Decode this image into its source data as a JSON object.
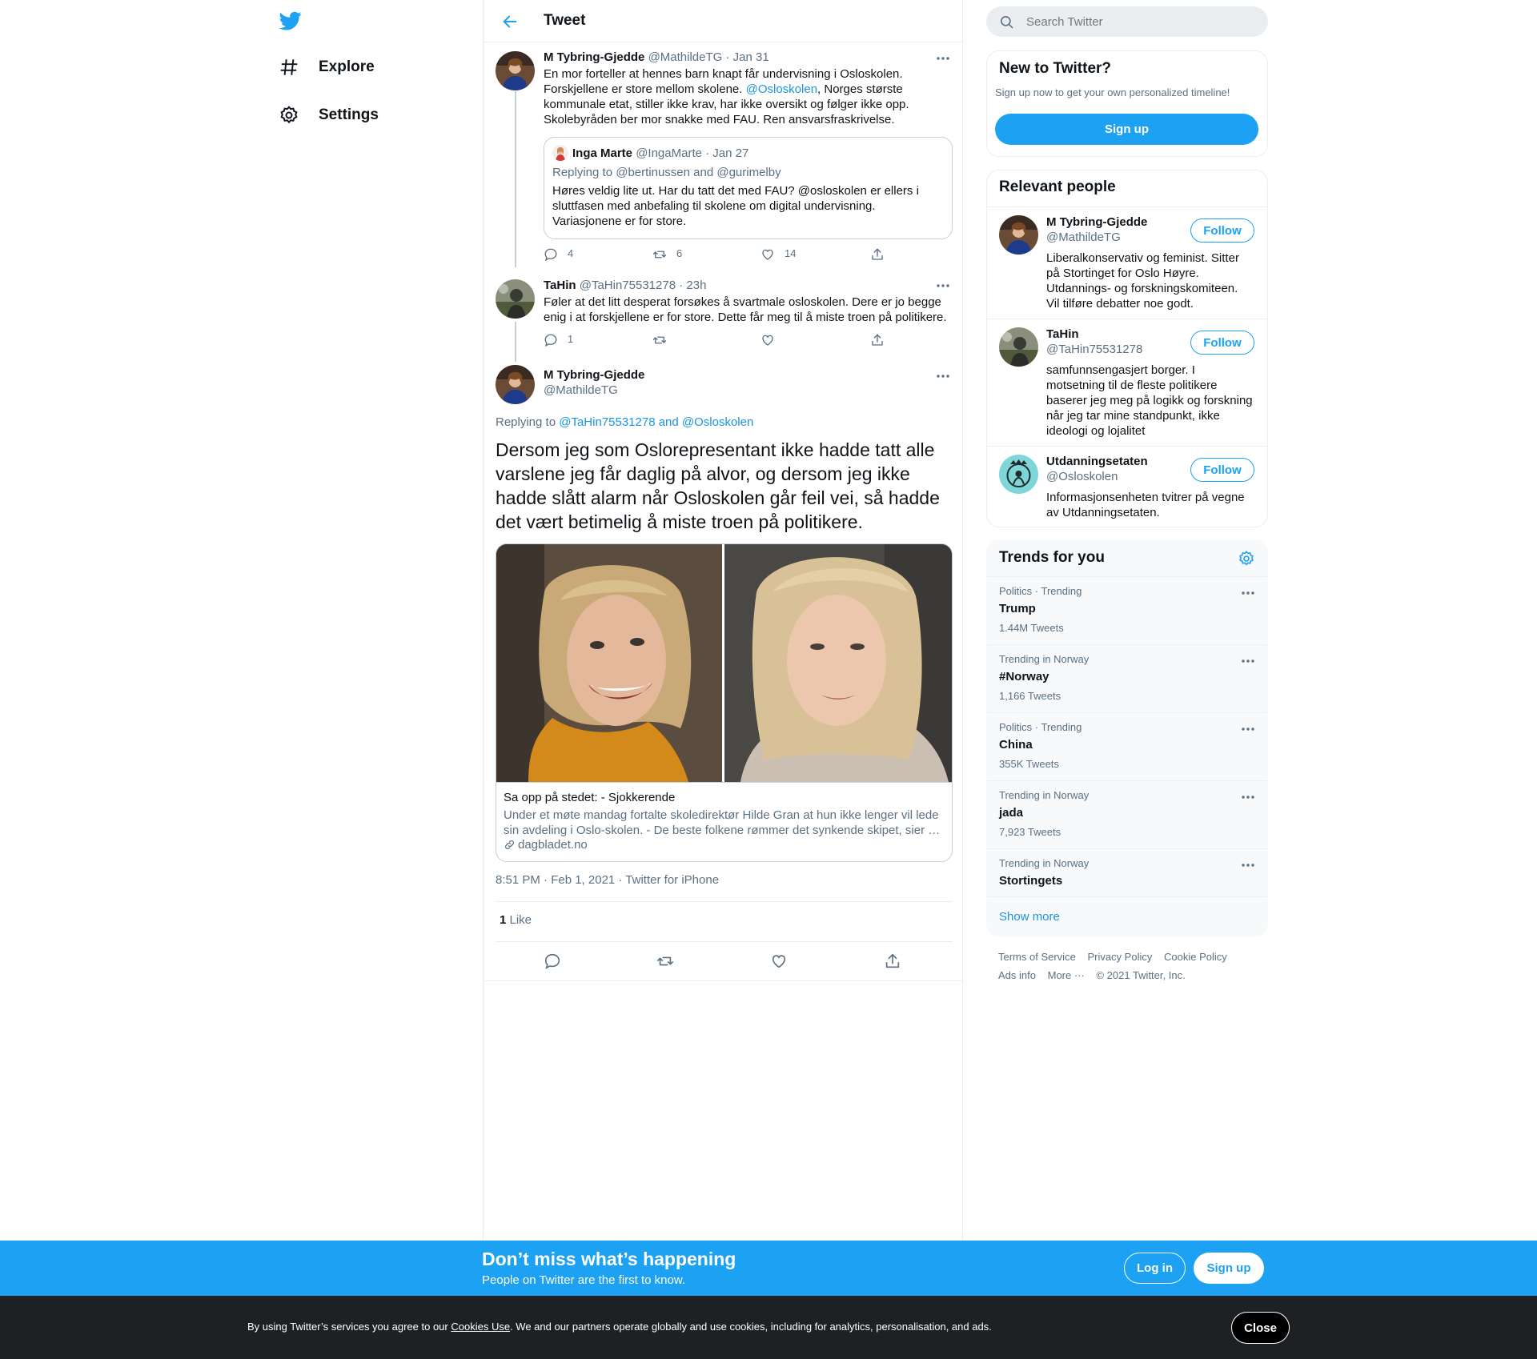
{
  "nav": {
    "logo": "twitter-bird-icon",
    "items": [
      {
        "label": "Explore",
        "icon": "hashtag-icon"
      },
      {
        "label": "Settings",
        "icon": "gear-icon"
      }
    ]
  },
  "header": {
    "title": "Tweet"
  },
  "thread": {
    "tweet1": {
      "name": "M Tybring-Gjedde",
      "handle": "@MathildeTG",
      "sep": "·",
      "date": "Jan 31",
      "text_a": "En mor forteller at hennes barn knapt får undervisning i Osloskolen.",
      "text_b1": "Forskjellene er store mellom skolene. ",
      "mention": "@Osloskolen",
      "text_b2": ", Norges største",
      "text_c": "kommunale etat, stiller ikke krav, har ikke oversikt og følger ikke opp.",
      "text_d": "Skolebyråden ber mor snakke med FAU. Ren ansvarsfraskrivelse.",
      "quote": {
        "name": "Inga Marte",
        "handle": "@IngaMarte",
        "sep": "·",
        "date": "Jan 27",
        "replying": "Replying to @bertinussen and @gurimelby",
        "line1": "Høres veldig lite ut. Har du tatt det med FAU? @osloskolen er ellers i",
        "line2": "sluttfasen med anbefaling til skolene om digital undervisning.",
        "line3": "Variasjonene er for store."
      },
      "replies": "4",
      "retweets": "6",
      "likes": "14"
    },
    "tweet2": {
      "name": "TaHin",
      "handle": "@TaHin75531278",
      "sep": "·",
      "date": "23h",
      "line1": "Føler at det litt desperat forsøkes å svartmale osloskolen. Dere er jo begge",
      "line2": "enig i at forskjellene er for store. Dette får meg til å miste troen på politikere.",
      "replies": "1"
    },
    "main": {
      "name": "M Tybring-Gjedde",
      "handle": "@MathildeTG",
      "replying_prefix": "Replying to ",
      "replying_to": "@TaHin75531278 and @Osloskolen",
      "line1": "Dersom jeg som Oslorepresentant ikke hadde tatt alle",
      "line2": "varslene jeg får daglig på alvor, og dersom jeg ikke",
      "line3": "hadde slått alarm når Osloskolen går feil vei, så hadde",
      "line4": "det vært betimelig å miste troen på politikere.",
      "card": {
        "title": "Sa opp på stedet: - Sjokkerende",
        "desc1": "Under et møte mandag fortalte skoledirektør Hilde Gran at hun ikke lenger vil lede",
        "desc2": "sin avdeling i Oslo-skolen. - De beste folkene rømmer det synkende skipet, sier …",
        "domain": "dagbladet.no"
      },
      "timestamp": "8:51 PM · Feb 1, 2021 · Twitter for iPhone",
      "like_count": "1",
      "like_label": " Like"
    }
  },
  "sidebar": {
    "search_placeholder": "Search Twitter",
    "new_to_twitter": {
      "title": "New to Twitter?",
      "subtitle": "Sign up now to get your own personalized timeline!",
      "button": "Sign up"
    },
    "relevant": {
      "title": "Relevant people",
      "follow_label": "Follow",
      "people": [
        {
          "name": "M Tybring-Gjedde",
          "handle": "@MathildeTG",
          "bio": [
            "Liberalkonservativ og feminist. Sitter",
            "på Stortinget for Oslo Høyre.",
            "Utdannings- og forskningskomiteen.",
            "Vil tilføre debatter noe godt."
          ]
        },
        {
          "name": "TaHin",
          "handle": "@TaHin75531278",
          "bio": [
            "samfunnsengasjert borger. I",
            "motsetning til de fleste politikere",
            "baserer jeg meg på logikk og forskning",
            "når jeg tar mine standpunkt, ikke",
            "ideologi og lojalitet"
          ]
        },
        {
          "name": "Utdanningsetaten",
          "handle": "@Osloskolen",
          "bio": [
            "Informasjonsenheten tvitrer på vegne",
            "av Utdanningsetaten."
          ]
        }
      ]
    },
    "trends": {
      "title": "Trends for you",
      "items": [
        {
          "context": "Politics · Trending",
          "name": "Trump",
          "count": "1.44M Tweets"
        },
        {
          "context": "Trending in Norway",
          "name": "#Norway",
          "count": "1,166 Tweets"
        },
        {
          "context": "Politics · Trending",
          "name": "China",
          "count": "355K Tweets"
        },
        {
          "context": "Trending in Norway",
          "name": "jada",
          "count": "7,923 Tweets"
        },
        {
          "context": "Trending in Norway",
          "name": "Stortingets",
          "count": ""
        }
      ],
      "show_more": "Show more"
    },
    "footer": {
      "links_row1": [
        "Terms of Service",
        "Privacy Policy",
        "Cookie Policy"
      ],
      "links_row2": [
        "Ads info",
        "More ···",
        "© 2021 Twitter, Inc."
      ]
    }
  },
  "signup_bar": {
    "heading": "Don’t miss what’s happening",
    "sub": "People on Twitter are the first to know.",
    "login": "Log in",
    "signup": "Sign up"
  },
  "cookie_bar": {
    "text_before": "By using Twitter’s services you agree to our ",
    "link": "Cookies Use",
    "text_after": ". We and our partners operate globally and use cookies, including for analytics, personalisation, and ads.",
    "close": "Close"
  },
  "colors": {
    "accent": "#1da1f2",
    "link": "#1b95e0",
    "muted": "#5b7083",
    "border": "#e6ecf0",
    "cookie_bg": "#1e2124"
  }
}
